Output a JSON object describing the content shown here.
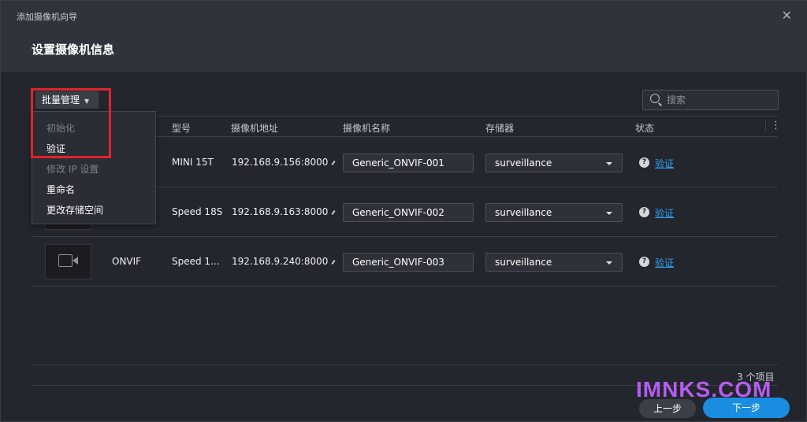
{
  "window": {
    "title": "添加摄像机向导",
    "close_icon": "close-icon"
  },
  "page_title": "设置摄像机信息",
  "toolbar": {
    "batch_label": "批量管理",
    "search_placeholder": "搜索"
  },
  "table": {
    "headers": [
      "型号",
      "摄像机地址",
      "摄像机名称",
      "存储器",
      "状态"
    ],
    "rows": [
      {
        "brand": "",
        "model": "MINI 15T",
        "address": "192.168.9.156:8000",
        "name": "Generic_ONVIF-001",
        "storage": "surveillance",
        "status": "验证"
      },
      {
        "brand": "",
        "model": "Speed 18S",
        "address": "192.168.9.163:8000",
        "name": "Generic_ONVIF-002",
        "storage": "surveillance",
        "status": "验证"
      },
      {
        "brand": "ONVIF",
        "model": "Speed 1...",
        "address": "192.168.9.240:8000",
        "name": "Generic_ONVIF-003",
        "storage": "surveillance",
        "status": "验证"
      }
    ]
  },
  "menu": {
    "items": [
      {
        "label": "初始化",
        "enabled": false
      },
      {
        "label": "验证",
        "enabled": true
      },
      {
        "label": "修改 IP 设置",
        "enabled": false
      },
      {
        "label": "重命名",
        "enabled": true
      },
      {
        "label": "更改存储空间",
        "enabled": true
      }
    ]
  },
  "footer": {
    "count": "3 个项目",
    "prev_label": "上一步",
    "next_label": "下一步"
  },
  "watermark": "IMNKS.COM",
  "colors": {
    "accent": "#1a8de0",
    "link": "#2ea3f2",
    "highlight": "#e0242b",
    "watermark": "#b65cf0"
  }
}
